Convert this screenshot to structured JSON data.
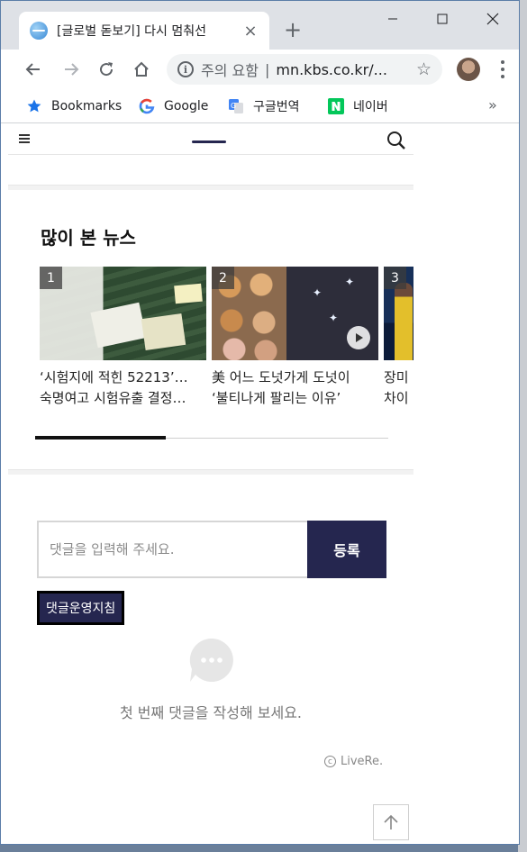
{
  "browser": {
    "tab_title": "[글로벌 돋보기] 다시 멈춰선",
    "security_label": "주의 요함",
    "separator": "|",
    "url": "mn.kbs.co.kr/...",
    "bookmarks": [
      {
        "label": "Bookmarks",
        "icon": "star-icon"
      },
      {
        "label": "Google",
        "icon": "google-icon"
      },
      {
        "label": "구글번역",
        "icon": "google-translate-icon"
      },
      {
        "label": "네이버",
        "icon": "naver-icon"
      }
    ],
    "overflow": "»"
  },
  "page": {
    "most_viewed_title": "많이 본 뉴스",
    "cards": [
      {
        "rank": "1",
        "title": "‘시험지에 적힌 52213’…",
        "subtitle": "숙명여고 시험유출 결정…"
      },
      {
        "rank": "2",
        "title": "美 어느 도넛가게 도넛이",
        "subtitle": "‘불티나게 팔리는 이유’"
      },
      {
        "rank": "3",
        "title": "장미",
        "subtitle": "차이"
      }
    ],
    "carousel_progress": 0.37,
    "comment": {
      "placeholder": "댓글을 입력해 주세요.",
      "submit_label": "등록",
      "guidelines_label": "댓글운영지침",
      "empty_text": "첫 번째 댓글을 작성해 보세요.",
      "copyright_symbol": "c",
      "powered_by": "LiveRe."
    }
  },
  "colors": {
    "brand_navy": "#25264f",
    "chrome_frame": "#dee1e6"
  }
}
